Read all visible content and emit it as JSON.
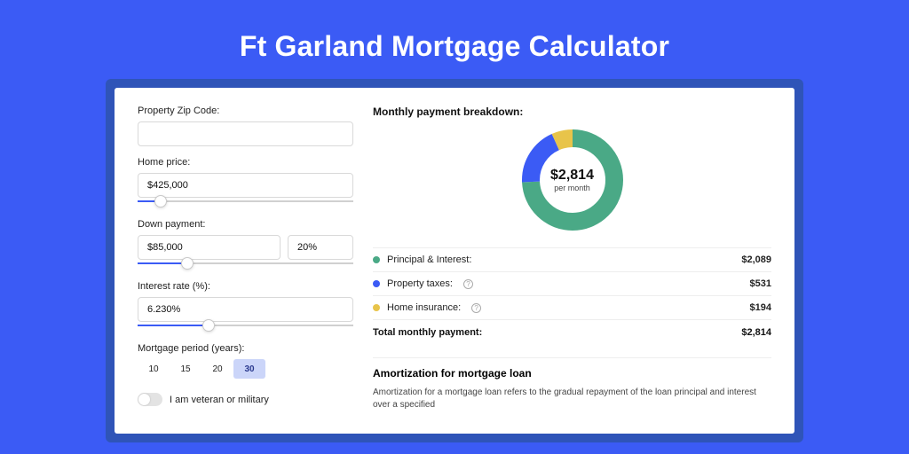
{
  "title": "Ft Garland Mortgage Calculator",
  "colors": {
    "pi": "#4aa986",
    "tax": "#3b5bf5",
    "ins": "#e8c44a"
  },
  "left": {
    "zip_label": "Property Zip Code:",
    "zip_value": "",
    "price_label": "Home price:",
    "price_value": "$425,000",
    "price_slider_pct": 8,
    "dp_label": "Down payment:",
    "dp_amount": "$85,000",
    "dp_percent": "20%",
    "dp_slider_pct": 20,
    "rate_label": "Interest rate (%):",
    "rate_value": "6.230%",
    "rate_slider_pct": 30,
    "period_label": "Mortgage period (years):",
    "periods": [
      "10",
      "15",
      "20",
      "30"
    ],
    "period_active": "30",
    "vet_label": "I am veteran or military"
  },
  "right": {
    "breakdown_title": "Monthly payment breakdown:",
    "center_amount": "$2,814",
    "center_sub": "per month",
    "legend": [
      {
        "label": "Principal & Interest:",
        "key": "pi",
        "amount": "$2,089",
        "help": false
      },
      {
        "label": "Property taxes:",
        "key": "tax",
        "amount": "$531",
        "help": true
      },
      {
        "label": "Home insurance:",
        "key": "ins",
        "amount": "$194",
        "help": true
      }
    ],
    "total_label": "Total monthly payment:",
    "total_amount": "$2,814",
    "amort_title": "Amortization for mortgage loan",
    "amort_text": "Amortization for a mortgage loan refers to the gradual repayment of the loan principal and interest over a specified"
  },
  "chart_data": {
    "type": "pie",
    "title": "Monthly payment breakdown",
    "series": [
      {
        "name": "Principal & Interest",
        "value": 2089,
        "color": "#4aa986"
      },
      {
        "name": "Property taxes",
        "value": 531,
        "color": "#3b5bf5"
      },
      {
        "name": "Home insurance",
        "value": 194,
        "color": "#e8c44a"
      }
    ],
    "total": 2814,
    "center_label": "$2,814 per month"
  }
}
